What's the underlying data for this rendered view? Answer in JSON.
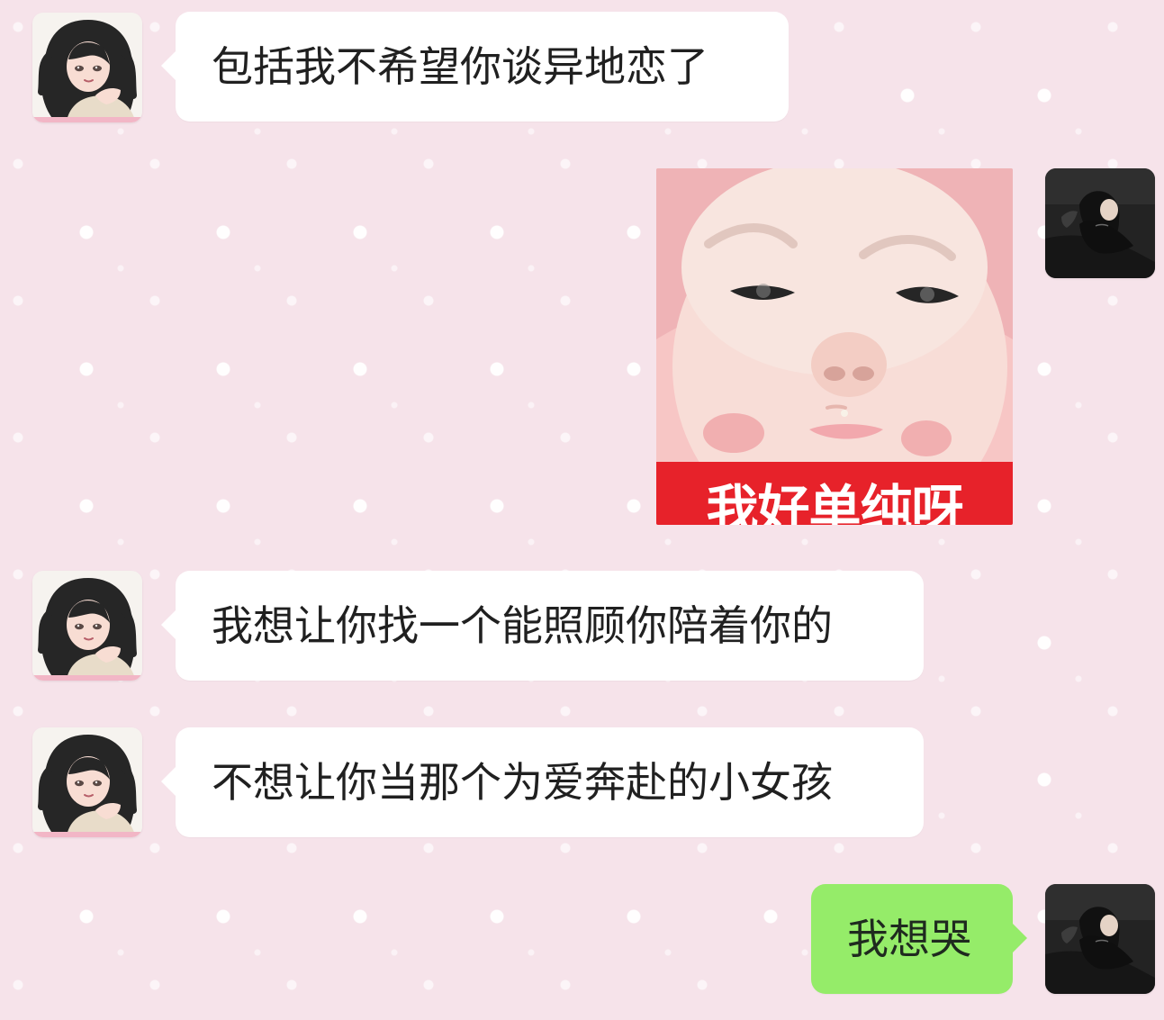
{
  "chat": {
    "messages": [
      {
        "side": "left",
        "type": "text",
        "text": "包括我不希望你谈异地恋了"
      },
      {
        "side": "right",
        "type": "sticker",
        "caption": "我好单纯呀"
      },
      {
        "side": "left",
        "type": "text",
        "text": "我想让你找一个能照顾你陪着你的"
      },
      {
        "side": "left",
        "type": "text",
        "text": "不想让你当那个为爱奔赴的小女孩"
      },
      {
        "side": "right",
        "type": "text",
        "text": "我想哭"
      }
    ]
  },
  "colors": {
    "background": "#f6e3ea",
    "incoming_bubble": "#ffffff",
    "outgoing_bubble": "#95ec69",
    "text": "#202020",
    "sticker_band": "#e7222a"
  },
  "icons": {
    "left_avatar": "anime-girl-avatar",
    "right_avatar": "dark-photo-avatar"
  }
}
